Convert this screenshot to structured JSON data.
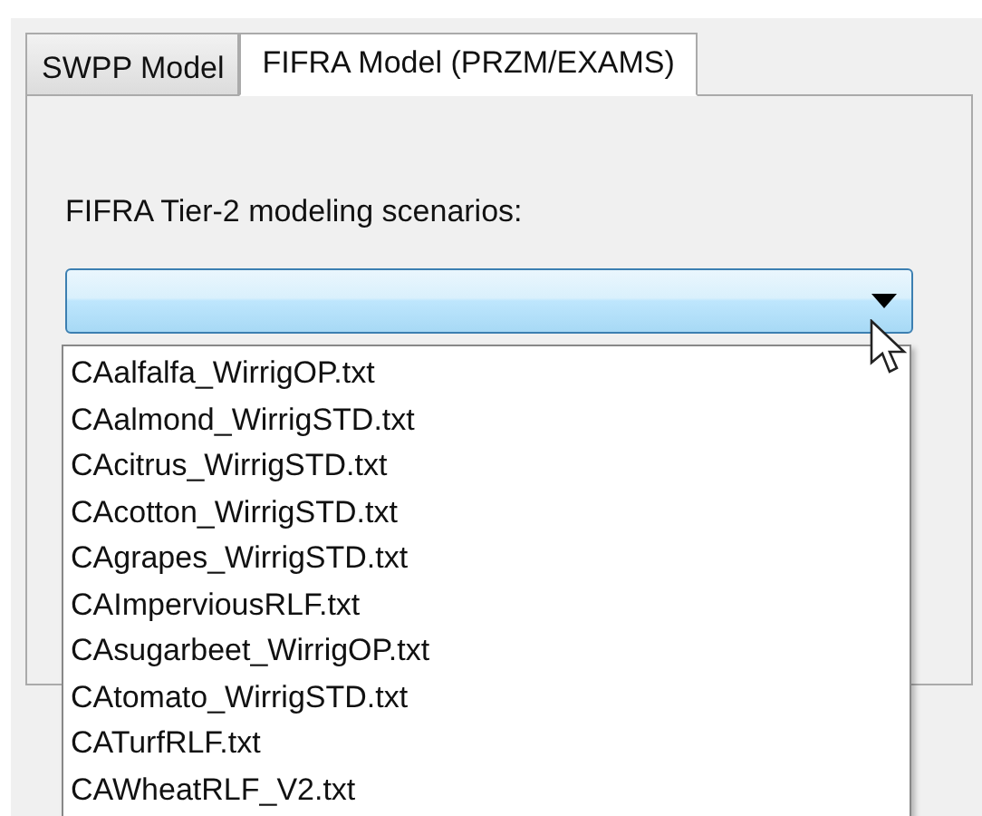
{
  "tabs": [
    {
      "label": "SWPP Model",
      "selected": false
    },
    {
      "label": "FIFRA Model (PRZM/EXAMS)",
      "selected": true
    }
  ],
  "panel": {
    "label": "FIFRA Tier-2 modeling scenarios:",
    "combo": {
      "expanded": true,
      "options": [
        {
          "label": "CAalfalfa_WirrigOP.txt"
        },
        {
          "label": "CAalmond_WirrigSTD.txt"
        },
        {
          "label": "CAcitrus_WirrigSTD.txt"
        },
        {
          "label": "CAcotton_WirrigSTD.txt"
        },
        {
          "label": "CAgrapes_WirrigSTD.txt"
        },
        {
          "label": "CAImperviousRLF.txt"
        },
        {
          "label": "CAsugarbeet_WirrigOP.txt"
        },
        {
          "label": "CAtomato_WirrigSTD.txt"
        },
        {
          "label": "CATurfRLF.txt"
        },
        {
          "label": "CAWheatRLF_V2.txt"
        }
      ]
    }
  }
}
